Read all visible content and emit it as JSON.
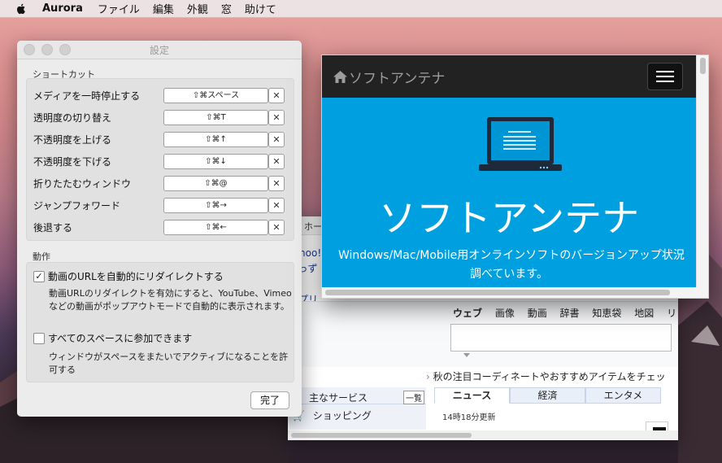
{
  "menubar": {
    "app": "Aurora",
    "items": [
      "ファイル",
      "編集",
      "外観",
      "窓",
      "助けて"
    ]
  },
  "settings": {
    "title": "設定",
    "shortcuts_label": "ショートカット",
    "shortcuts": [
      {
        "label": "メディアを一時停止する",
        "key": "⇧⌘スペース"
      },
      {
        "label": "透明度の切り替え",
        "key": "⇧⌘T"
      },
      {
        "label": "不透明度を上げる",
        "key": "⇧⌘↑"
      },
      {
        "label": "不透明度を下げる",
        "key": "⇧⌘↓"
      },
      {
        "label": "折りたたむウィンドウ",
        "key": "⇧⌘@"
      },
      {
        "label": "ジャンプフォワード",
        "key": "⇧⌘→"
      },
      {
        "label": "後退する",
        "key": "⇧⌘←"
      }
    ],
    "clear_symbol": "✕",
    "behavior_label": "動作",
    "option1": {
      "label": "動画のURLを自動的にリダイレクトする",
      "checked_mark": "✓",
      "desc": "動画URLのリダイレクトを有効にすると、YouTube、Vimeoなどの動画がポップアウトモードで自動的に表示されます。"
    },
    "option2": {
      "label": "すべてのスペースに参加できます",
      "desc": "ウィンドウがスペースをまたいでアクティブになることを許可する"
    },
    "done_label": "完了"
  },
  "browser": {
    "tab_text": "ホー",
    "yahoo_lines": [
      "Yahoo!",
      "きっず版",
      "アプリ版"
    ],
    "search_tabs": [
      "ウェブ",
      "画像",
      "動画",
      "辞書",
      "知恵袋",
      "地図",
      "リ"
    ],
    "promo": "秋の注目コーディネートやおすすめアイテムをチェッ",
    "services_label": "主なサービス",
    "list_button": "一覧",
    "shopping": "ショッピング",
    "news_tabs": [
      "ニュース",
      "経済",
      "エンタメ"
    ],
    "timestamp": "14時18分更新"
  },
  "popup": {
    "brand": "ソフトアンテナ",
    "hero_title": "ソフトアンテナ",
    "hero_sub_line1": "Windows/Mac/Mobile用オンラインソフトのバージョンアップ状況",
    "hero_sub_line2": "調べています。"
  },
  "colors": {
    "hero_blue": "#00a0e0",
    "nav_dark": "#222222"
  }
}
